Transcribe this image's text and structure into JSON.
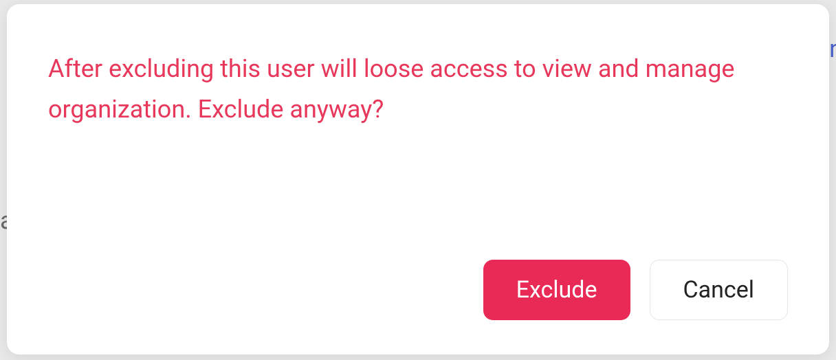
{
  "modal": {
    "message": "After excluding this user will loose access to view and manage organization. Exclude anyway?",
    "actions": {
      "confirm_label": "Exclude",
      "cancel_label": "Cancel"
    }
  }
}
